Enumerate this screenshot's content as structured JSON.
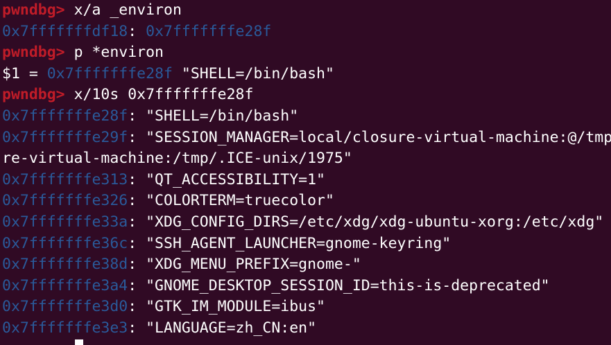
{
  "colors": {
    "background": "#300a24",
    "prompt": "#c01c28",
    "address": "#2a5a9a",
    "text": "#ffffff"
  },
  "lines": [
    {
      "prompt": "pwndbg> ",
      "cmd": "x/a _environ"
    },
    {
      "addr": "0x7fffffffdf18",
      "sep": ": ",
      "val_addr": "0x7fffffffe28f"
    },
    {
      "prompt": "pwndbg> ",
      "cmd": "p *environ"
    },
    {
      "pre": "$1 = ",
      "addr": "0x7fffffffe28f",
      "str": " \"SHELL=/bin/bash\""
    },
    {
      "prompt": "pwndbg> ",
      "cmd": "x/10s 0x7fffffffe28f"
    },
    {
      "addr": "0x7fffffffe28f",
      "str": ": \"SHELL=/bin/bash\""
    },
    {
      "addr": "0x7fffffffe29f",
      "str": ": \"SESSION_MANAGER=local/closure-virtual-machine:@/tmp"
    },
    {
      "str": "re-virtual-machine:/tmp/.ICE-unix/1975\""
    },
    {
      "addr": "0x7fffffffe313",
      "str": ": \"QT_ACCESSIBILITY=1\""
    },
    {
      "addr": "0x7fffffffe326",
      "str": ": \"COLORTERM=truecolor\""
    },
    {
      "addr": "0x7fffffffe33a",
      "str": ": \"XDG_CONFIG_DIRS=/etc/xdg/xdg-ubuntu-xorg:/etc/xdg\""
    },
    {
      "addr": "0x7fffffffe36c",
      "str": ": \"SSH_AGENT_LAUNCHER=gnome-keyring\""
    },
    {
      "addr": "0x7fffffffe38d",
      "str": ": \"XDG_MENU_PREFIX=gnome-\""
    },
    {
      "addr": "0x7fffffffe3a4",
      "str": ": \"GNOME_DESKTOP_SESSION_ID=this-is-deprecated\""
    },
    {
      "addr": "0x7fffffffe3d0",
      "str": ": \"GTK_IM_MODULE=ibus\""
    },
    {
      "addr": "0x7fffffffe3e3",
      "str": ": \"LANGUAGE=zh_CN:en\""
    }
  ]
}
